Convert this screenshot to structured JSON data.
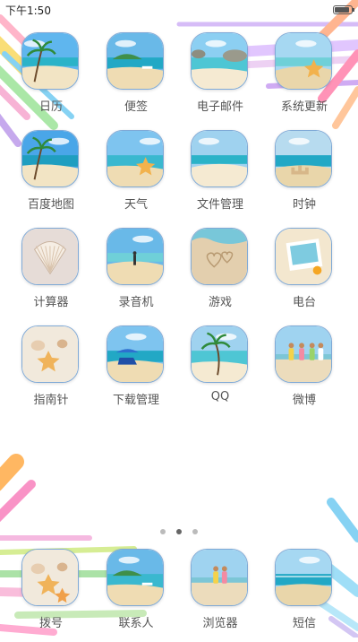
{
  "status_bar": {
    "time": "下午1:50",
    "battery_level": 0.9
  },
  "pages": {
    "count": 3,
    "current": 2
  },
  "apps": [
    {
      "label": "日历",
      "icon": "beach-palm-calendar-icon"
    },
    {
      "label": "便签",
      "icon": "island-boat-notes-icon"
    },
    {
      "label": "电子邮件",
      "icon": "rocks-sea-mail-icon"
    },
    {
      "label": "系统更新",
      "icon": "starfish-beach-update-icon"
    },
    {
      "label": "百度地图",
      "icon": "palm-beach-map-icon"
    },
    {
      "label": "天气",
      "icon": "starfish-sea-weather-icon"
    },
    {
      "label": "文件管理",
      "icon": "sand-beach-files-icon"
    },
    {
      "label": "时钟",
      "icon": "sand-castle-clock-icon"
    },
    {
      "label": "计算器",
      "icon": "seashell-calculator-icon"
    },
    {
      "label": "录音机",
      "icon": "person-sea-recorder-icon"
    },
    {
      "label": "游戏",
      "icon": "hearts-sand-game-icon"
    },
    {
      "label": "电台",
      "icon": "photo-frame-radio-icon"
    },
    {
      "label": "指南针",
      "icon": "shells-starfish-compass-icon"
    },
    {
      "label": "下载管理",
      "icon": "beach-chair-download-icon"
    },
    {
      "label": "QQ",
      "icon": "palm-tree-qq-icon"
    },
    {
      "label": "微博",
      "icon": "friends-beach-weibo-icon"
    }
  ],
  "dock": [
    {
      "label": "拨号",
      "icon": "starfish-sand-phone-icon"
    },
    {
      "label": "联系人",
      "icon": "island-sea-contacts-icon"
    },
    {
      "label": "浏览器",
      "icon": "couple-beach-browser-icon"
    },
    {
      "label": "短信",
      "icon": "sea-sky-sms-icon"
    }
  ]
}
